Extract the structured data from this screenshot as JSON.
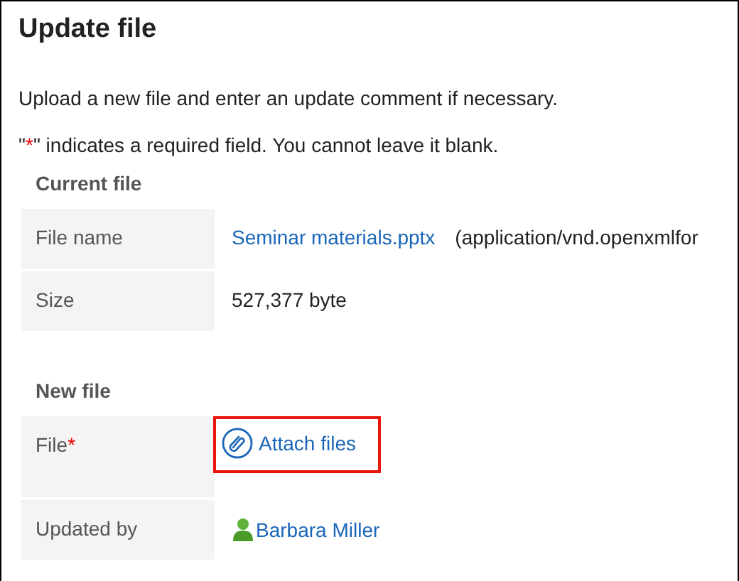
{
  "title": "Update file",
  "intro": "Upload a new file and enter an update comment if necessary.",
  "required_note": {
    "before": "\"",
    "mark": "*",
    "after": "\" indicates a required field. You cannot leave it blank."
  },
  "sections": [
    {
      "heading": "Current file",
      "rows": [
        {
          "label": "File name",
          "required": false,
          "kind": "file_link",
          "value": "Seminar materials.pptx",
          "detail": "(application/vnd.openxmlfor"
        },
        {
          "label": "Size",
          "required": false,
          "kind": "text",
          "value": "527,377 byte"
        }
      ]
    },
    {
      "heading": "New file",
      "rows": [
        {
          "label": "File",
          "required": true,
          "kind": "attach",
          "value": "Attach files",
          "highlighted": true
        },
        {
          "label": "Updated by",
          "required": false,
          "kind": "user",
          "value": "Barbara Miller"
        }
      ]
    }
  ]
}
